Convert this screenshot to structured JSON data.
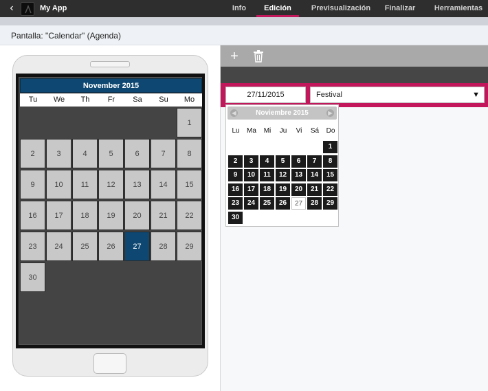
{
  "topbar": {
    "back_icon": "chevron-left-icon",
    "app_name": "My App",
    "nav": [
      "Info",
      "Edición",
      "Previsualización",
      "Finalizar",
      "Herramientas"
    ],
    "active_nav": "Edición",
    "accent": "#c2185b"
  },
  "screen_title": "Pantalla: \"Calendar\" (Agenda)",
  "phone_calendar": {
    "month_label": "November 2015",
    "weekdays": [
      "Tu",
      "We",
      "Th",
      "Fr",
      "Sa",
      "Su",
      "Mo"
    ],
    "days": [
      "1",
      "2",
      "3",
      "4",
      "5",
      "6",
      "7",
      "8",
      "9",
      "10",
      "11",
      "12",
      "13",
      "14",
      "15",
      "16",
      "17",
      "18",
      "19",
      "20",
      "21",
      "22",
      "23",
      "24",
      "25",
      "26",
      "27",
      "28",
      "29",
      "30"
    ],
    "selected_day": "27",
    "header_color": "#0e4872"
  },
  "editor": {
    "toolbar_icons": [
      "plus-icon",
      "trash-icon"
    ],
    "date_value": "27/11/2015",
    "type_value": "Festival",
    "band_color": "#c2185b"
  },
  "picker": {
    "month_label": "Noviembre 2015",
    "weekdays": [
      "Lu",
      "Ma",
      "Mi",
      "Ju",
      "Vi",
      "Sá",
      "Do"
    ],
    "days": [
      "1",
      "2",
      "3",
      "4",
      "5",
      "6",
      "7",
      "8",
      "9",
      "10",
      "11",
      "12",
      "13",
      "14",
      "15",
      "16",
      "17",
      "18",
      "19",
      "20",
      "21",
      "22",
      "23",
      "24",
      "25",
      "26",
      "27",
      "28",
      "29",
      "30"
    ],
    "today": "27",
    "prev_icon": "prev-circle-icon",
    "next_icon": "next-circle-icon"
  }
}
